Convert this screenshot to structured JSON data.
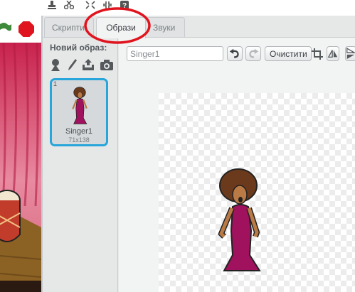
{
  "tabs": {
    "scripts": "Скрипти",
    "costumes": "Образи",
    "sounds": "Звуки"
  },
  "costume_list": {
    "new_costume_label": "Новий образ:",
    "items": [
      {
        "number": "1",
        "name": "Singer1",
        "size": "71x138"
      }
    ]
  },
  "editor": {
    "costume_name": "Singer1",
    "clear_label": "Очистити"
  },
  "colors": {
    "accent": "#28a5da",
    "highlight": "#e0141e",
    "stop": "#e0141e"
  },
  "icons": [
    "stamp-icon",
    "cut-icon",
    "grow-icon",
    "shrink-icon",
    "help-icon",
    "flag-icon",
    "stop-icon",
    "paint-brush-icon",
    "upload-icon",
    "camera-icon",
    "undo-icon",
    "redo-icon",
    "crop-icon",
    "flip-horizontal-icon",
    "flip-vertical-icon"
  ]
}
